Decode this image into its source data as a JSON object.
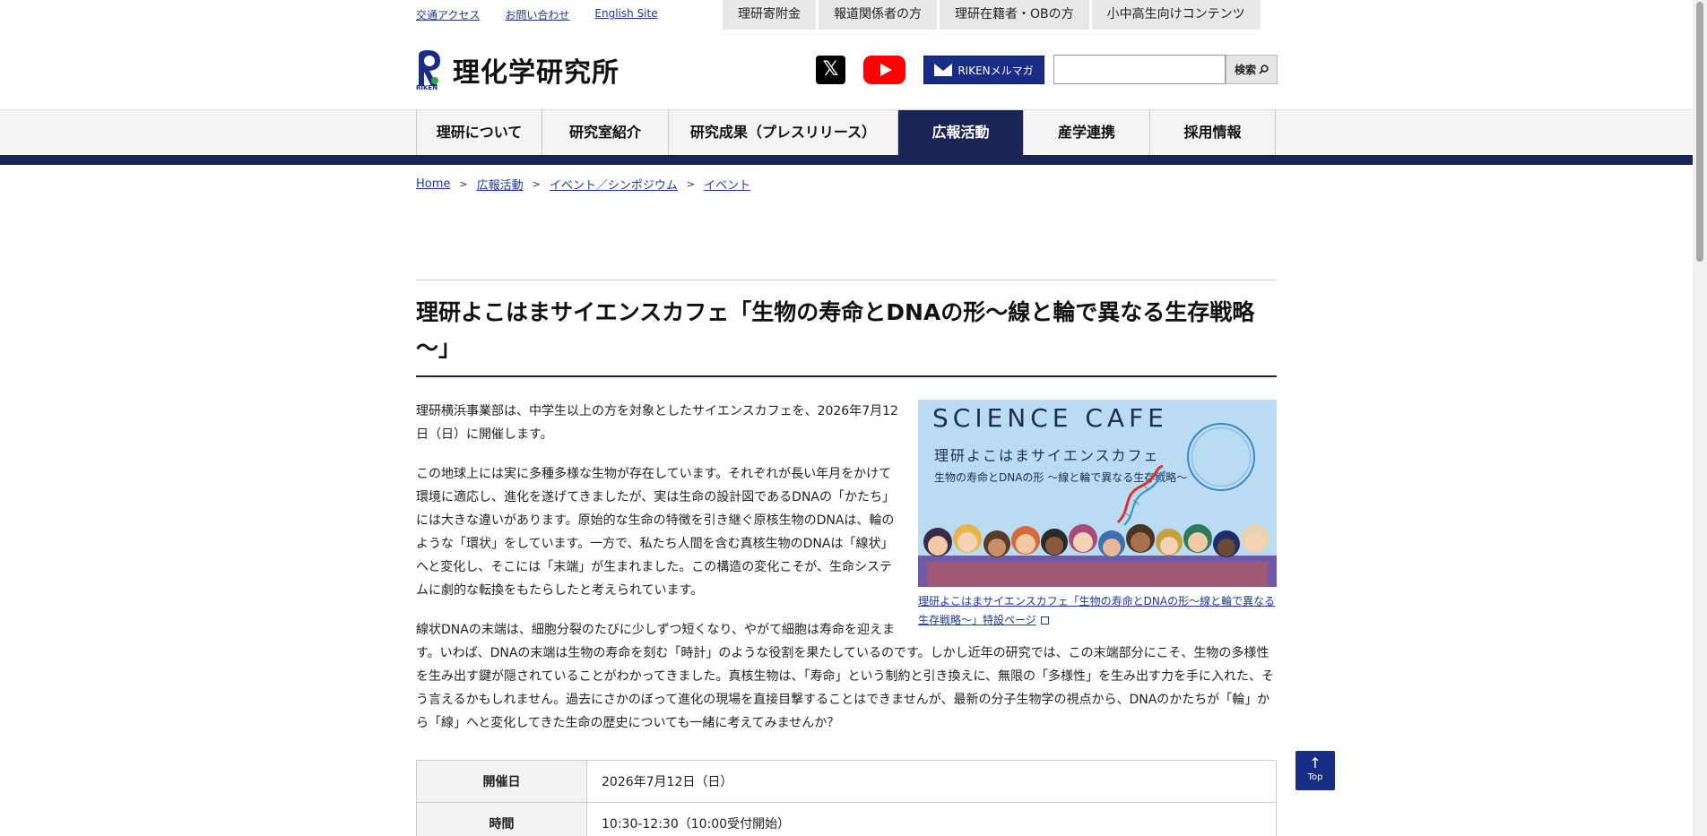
{
  "util_links": [
    "交通アクセス",
    "お問い合わせ",
    "English Site"
  ],
  "util_tabs": [
    "理研寄附金",
    "報道関係者の方",
    "理研在籍者・OBの方",
    "小中高生向けコンテンツ"
  ],
  "logo": {
    "text": "理化学研究所",
    "sub": "RIKEN"
  },
  "social": {
    "x_label": "𝕏"
  },
  "mail_button": "RIKENメルマガ",
  "search": {
    "button": "検索",
    "placeholder": ""
  },
  "nav": [
    "理研について",
    "研究室紹介",
    "研究成果（プレスリリース）",
    "広報活動",
    "産学連携",
    "採用情報"
  ],
  "breadcrumb": [
    "Home",
    "広報活動",
    "イベント／シンポジウム",
    "イベント"
  ],
  "title": "理研よこはまサイエンスカフェ「生物の寿命とDNAの形～線と輪で異なる生存戦略～」",
  "paragraphs": [
    "理研横浜事業部は、中学生以上の方を対象としたサイエンスカフェを、2026年7月12日（日）に開催します。",
    "この地球上には実に多種多様な生物が存在しています。それぞれが長い年月をかけて環境に適応し、進化を遂げてきましたが、実は生命の設計図であるDNAの「かたち」には大きな違いがあります。原始的な生命の特徴を引き継ぐ原核生物のDNAは、輪のような「環状」をしています。一方で、私たち人間を含む真核生物のDNAは「線状」へと変化し、そこには「末端」が生まれました。この構造の変化こそが、生命システムに劇的な転換をもたらしたと考えられています。",
    "線状DNAの末端は、細胞分裂のたびに少しずつ短くなり、やがて細胞は寿命を迎えます。いわば、DNAの末端は生物の寿命を刻む「時計」のような役割を果たしているのです。しかし近年の研究では、この末端部分にこそ、生物の多様性を生み出す鍵が隠されていることがわかってきました。真核生物は、「寿命」という制約と引き換えに、無限の「多様性」を生み出す力を手に入れた、そう言えるかもしれません。過去にさかのぼって進化の現場を直接目撃することはできませんが、最新の分子生物学の視点から、DNAのかたちが「輪」から「線」へと変化してきた生命の歴史についても一緒に考えてみませんか？"
  ],
  "promo": {
    "science_cafe": "SCIENCE CAFE",
    "line1": "理研よこはまサイエンスカフェ",
    "line2": "生物の寿命とDNAの形 ～線と輪で異なる生存戦略～"
  },
  "caption": "理研よこはまサイエンスカフェ「生物の寿命とDNAの形～線と輪で異なる生存戦略～」特設ページ",
  "table": [
    {
      "label": "開催日",
      "value": "2026年7月12日（日）"
    },
    {
      "label": "時間",
      "value": "10:30-12:30（10:00受付開始）"
    }
  ],
  "top_button": "Top",
  "colors": {
    "navy": "#1a2455",
    "link": "#1f3a93",
    "youtube": "#ff0000"
  }
}
